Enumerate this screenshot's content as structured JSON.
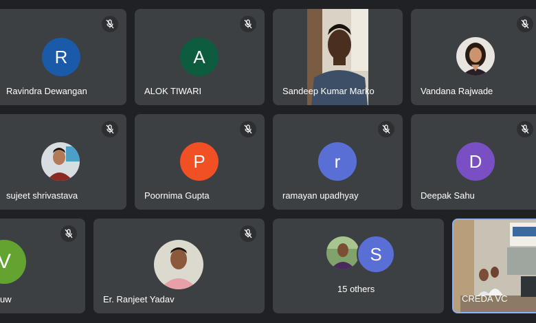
{
  "participants": [
    {
      "name": "Ravindra Dewangan",
      "initial": "R",
      "color": "#1a5aa8",
      "muted": true
    },
    {
      "name": "ALOK TIWARI",
      "initial": "A",
      "color": "#0d5c3f",
      "muted": true
    },
    {
      "name": "Sandeep Kumar Marko",
      "muted": false,
      "video": true
    },
    {
      "name": "Vandana Rajwade",
      "muted": true,
      "photo": true
    },
    {
      "name": "sujeet shrivastava",
      "muted": true,
      "photo": true
    },
    {
      "name": "Poornima Gupta",
      "initial": "P",
      "color": "#f05023",
      "muted": true
    },
    {
      "name": "ramayan upadhyay",
      "initial": "r",
      "color": "#5a6fd6",
      "muted": true
    },
    {
      "name": "Deepak Sahu",
      "initial": "D",
      "color": "#7b4fc4",
      "muted": true
    },
    {
      "name": "uw",
      "initial": "V",
      "color": "#63a431",
      "muted": true
    },
    {
      "name": "Er. Ranjeet Yadav",
      "muted": true,
      "photo": true
    },
    {
      "name": "CREDA VC",
      "muted": false,
      "video": true,
      "active_speaker": true
    }
  ],
  "others": {
    "label": "15 others",
    "initial": "S",
    "color": "#5a6fd6"
  },
  "colors": {
    "background": "#202124",
    "tile": "#3c4043",
    "active_border": "#8ab4f8"
  }
}
